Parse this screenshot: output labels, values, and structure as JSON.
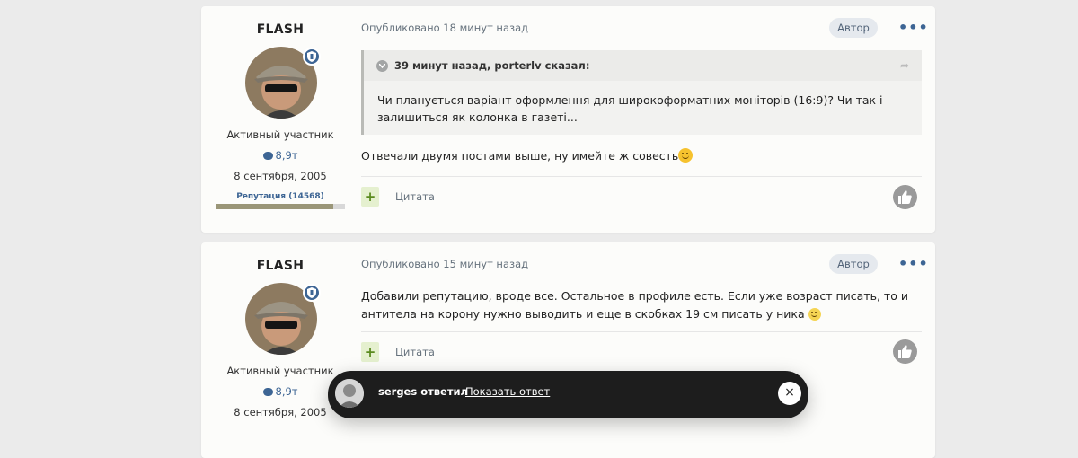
{
  "posts": [
    {
      "author": "FLASH",
      "rank": "Активный участник",
      "post_count": "8,9т",
      "joined": "8 сентября, 2005",
      "reputation_label": "Репутация (14568)",
      "reputation_fill": 0.91,
      "published": "Опубликовано 18 минут назад",
      "author_badge": "Автор",
      "more": "•••",
      "quote": {
        "title": "39 минут назад, porterlv сказал:",
        "text": "Чи планується варіант оформлення для широкоформатних моніторів (16:9)? Чи так і залишиться як колонка в газеті..."
      },
      "text": "Отвечали двумя постами выше, ну имейте ж совесть",
      "plus": "+",
      "cite": "Цитата"
    },
    {
      "author": "FLASH",
      "rank": "Активный участник",
      "post_count": "8,9т",
      "joined": "8 сентября, 2005",
      "published": "Опубликовано 15 минут назад",
      "author_badge": "Автор",
      "more": "•••",
      "text": "Добавили репутацию, вроде все. Остальное в профиле есть. Если уже возраст писать, то и антитела на корону нужно выводить и еще в скобках 19 см писать у ника",
      "plus": "+",
      "cite": "Цитата"
    }
  ],
  "toast": {
    "message": "serges ответил",
    "link": "Показать ответ",
    "close": "×"
  },
  "icons": {
    "shield": "shield-icon",
    "comment": "comment-icon",
    "chevron": "chevron-down-icon",
    "share": "share-icon",
    "thumb": "thumbs-up-icon",
    "smile": "smile-emoji"
  },
  "colors": {
    "accent": "#3d6594",
    "plus_bg": "#e5f0cf",
    "toast_bg": "#1d1d1d"
  }
}
